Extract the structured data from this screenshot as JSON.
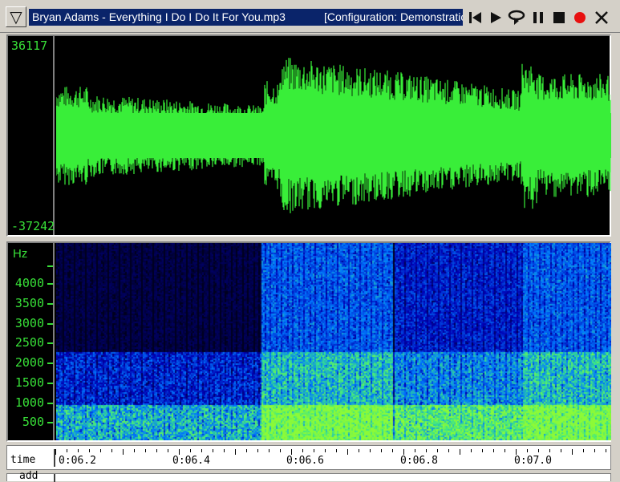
{
  "window": {
    "file_title": "Bryan Adams - Everything I Do I Do It For You.mp3",
    "config_title": "[Configuration: Demonstration"
  },
  "toolbar": {
    "buttons": [
      {
        "name": "skip-to-start-icon"
      },
      {
        "name": "play-icon"
      },
      {
        "name": "play-loop-icon"
      },
      {
        "name": "pause-icon"
      },
      {
        "name": "stop-icon"
      },
      {
        "name": "record-icon",
        "color": "#e81010"
      },
      {
        "name": "close-icon"
      }
    ]
  },
  "waveform": {
    "y_max": "36117",
    "y_min": "-37242",
    "color": "#39ee39"
  },
  "spectrogram": {
    "unit": "Hz",
    "ticks": [
      "4000",
      "3500",
      "3000",
      "2500",
      "2000",
      "1500",
      "1000",
      "500"
    ]
  },
  "time_axis": {
    "label": "time",
    "ticks": [
      "0:06.2",
      "0:06.4",
      "0:06.6",
      "0:06.8",
      "0:07.0"
    ]
  },
  "bottom_row": {
    "label": "add"
  }
}
